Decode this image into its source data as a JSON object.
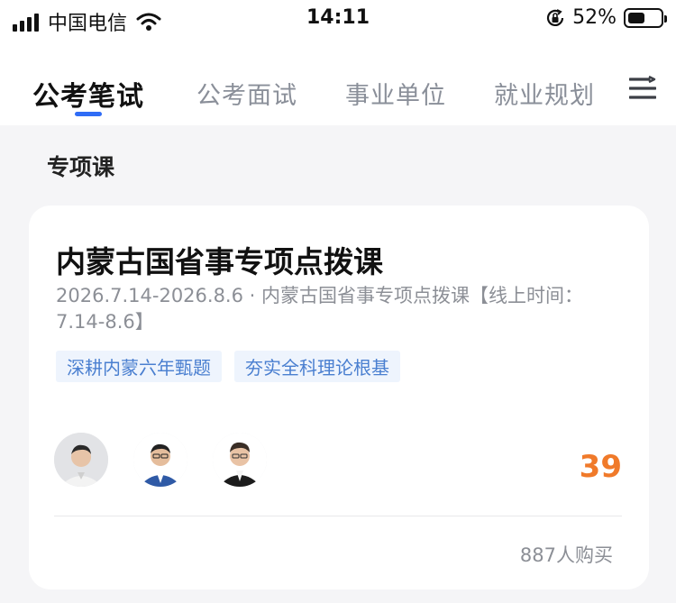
{
  "status_bar": {
    "carrier": "中国电信",
    "time": "14:11",
    "battery_percent": "52%",
    "battery_level": 0.52
  },
  "tabs": [
    {
      "label": "公考笔试",
      "active": true
    },
    {
      "label": "公考面试",
      "active": false
    },
    {
      "label": "事业单位",
      "active": false
    },
    {
      "label": "就业规划",
      "active": false
    }
  ],
  "section": {
    "title": "专项课"
  },
  "course": {
    "title": "内蒙古国省事专项点拨课",
    "description": "2026.7.14-2026.8.6 · 内蒙古国省事专项点拨课【线上时间：7.14-8.6】",
    "tags": [
      "深耕内蒙六年甄题",
      "夯实全科理论根基"
    ],
    "teacher_count": 3,
    "price": "39",
    "buyers": "887人购买"
  },
  "colors": {
    "accent": "#2f6cf6",
    "price": "#f07a2a",
    "tag_text": "#4a7fd0",
    "tag_bg": "#eef4fd"
  }
}
